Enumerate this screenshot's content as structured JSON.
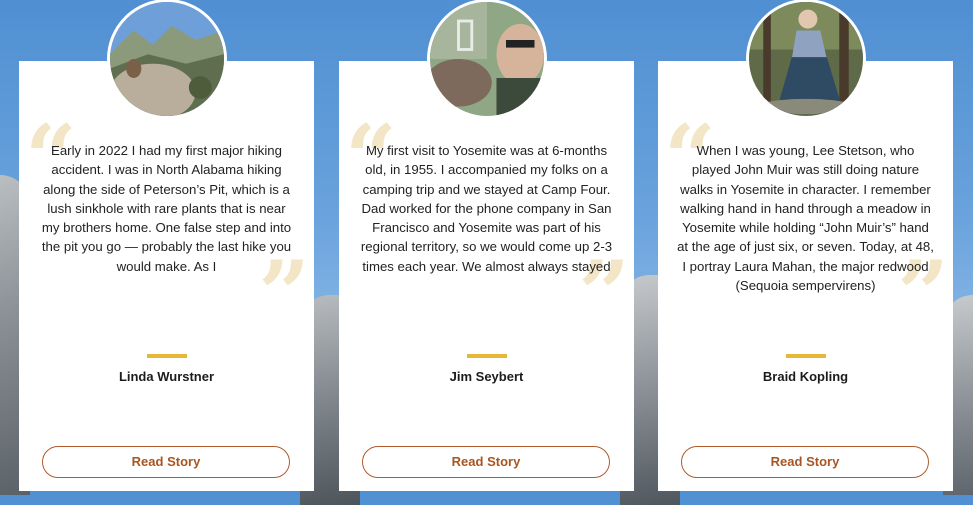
{
  "cards": [
    {
      "name": "Linda Wurstner",
      "story": "Early in 2022 I had my first major hiking accident. I was in North Alabama hiking along the side of Peterson’s Pit, which is a lush sinkhole with rare plants that is near my brothers home. One false step and into the pit you go — probably the last hike you would make. As I",
      "button": "Read Story",
      "quote_open": "“",
      "quote_close": "”"
    },
    {
      "name": "Jim Seybert",
      "story": "My first visit to Yosemite was at 6-months old, in 1955. I accompanied my folks on a camping trip and we stayed at Camp Four. Dad worked for the phone company in San Francisco and Yosemite was part of his regional territory, so we would come up 2-3 times each year. We almost always stayed",
      "button": "Read Story",
      "quote_open": "“",
      "quote_close": "”"
    },
    {
      "name": "Braid Kopling",
      "story": "When I was young, Lee Stetson, who played John Muir was still doing nature walks in Yosemite in character. I remember walking hand in hand through a meadow in Yosemite while holding “John Muir’s” hand at the age of just six, or seven. Today, at 48, I portray Laura Mahan, the major redwood (Sequoia sempervirens)",
      "button": "Read Story",
      "quote_open": "“",
      "quote_close": "”"
    }
  ],
  "colors": {
    "accent_divider": "#e7b737",
    "button_text": "#a8551f",
    "button_border": "#b15a2c",
    "quote_mark": "#f3e6c6"
  }
}
